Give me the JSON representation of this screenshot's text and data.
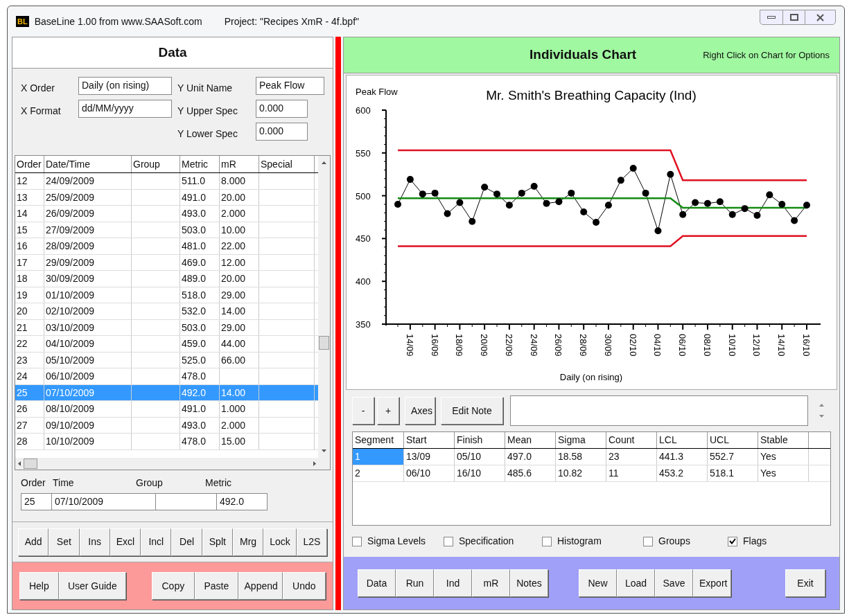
{
  "window": {
    "title": "BaseLine 1.00  from www.SAASoft.com",
    "project": "Project: \"Recipes XmR - 4f.bpf\"",
    "app_icon": "BL"
  },
  "data_panel": {
    "title": "Data",
    "fields": [
      {
        "label": "X Order",
        "value": "Daily (on rising)"
      },
      {
        "label": "X Format",
        "value": "dd/MM/yyyy"
      },
      {
        "label": "Y Unit Name",
        "value": "Peak Flow"
      },
      {
        "label": "Y Upper Spec",
        "value": "0.000"
      },
      {
        "label": "Y Lower Spec",
        "value": "0.000"
      }
    ],
    "table": {
      "columns": [
        "Order",
        "Date/Time",
        "Group",
        "Metric",
        "mR",
        "Special"
      ],
      "rows": [
        {
          "order": "12",
          "date": "24/09/2009",
          "metric": "511.0",
          "mr": "8.000",
          "selected": false
        },
        {
          "order": "13",
          "date": "25/09/2009",
          "metric": "491.0",
          "mr": "20.00",
          "selected": false
        },
        {
          "order": "14",
          "date": "26/09/2009",
          "metric": "493.0",
          "mr": "2.000",
          "selected": false
        },
        {
          "order": "15",
          "date": "27/09/2009",
          "metric": "503.0",
          "mr": "10.00",
          "selected": false
        },
        {
          "order": "16",
          "date": "28/09/2009",
          "metric": "481.0",
          "mr": "22.00",
          "selected": false
        },
        {
          "order": "17",
          "date": "29/09/2009",
          "metric": "469.0",
          "mr": "12.00",
          "selected": false
        },
        {
          "order": "18",
          "date": "30/09/2009",
          "metric": "489.0",
          "mr": "20.00",
          "selected": false
        },
        {
          "order": "19",
          "date": "01/10/2009",
          "metric": "518.0",
          "mr": "29.00",
          "selected": false
        },
        {
          "order": "20",
          "date": "02/10/2009",
          "metric": "532.0",
          "mr": "14.00",
          "selected": false
        },
        {
          "order": "21",
          "date": "03/10/2009",
          "metric": "503.0",
          "mr": "29.00",
          "selected": false
        },
        {
          "order": "22",
          "date": "04/10/2009",
          "metric": "459.0",
          "mr": "44.00",
          "selected": false
        },
        {
          "order": "23",
          "date": "05/10/2009",
          "metric": "525.0",
          "mr": "66.00",
          "selected": false
        },
        {
          "order": "24",
          "date": "06/10/2009",
          "metric": "478.0",
          "selected": false
        },
        {
          "order": "25",
          "date": "07/10/2009",
          "metric": "492.0",
          "mr": "14.00",
          "selected": true
        },
        {
          "order": "26",
          "date": "08/10/2009",
          "metric": "491.0",
          "mr": "1.000",
          "selected": false
        },
        {
          "order": "27",
          "date": "09/10/2009",
          "metric": "493.0",
          "mr": "2.000",
          "selected": false
        },
        {
          "order": "28",
          "date": "10/10/2009",
          "metric": "478.0",
          "mr": "15.00",
          "selected": false
        }
      ]
    },
    "editor": {
      "labels": [
        "Order",
        "Time",
        "Group",
        "Metric"
      ],
      "order": "25",
      "time": "07/10/2009",
      "metric": "492.0"
    },
    "edit_buttons": [
      "Add",
      "Set",
      "Ins",
      "Excl",
      "Incl",
      "Del",
      "Splt",
      "Mrg",
      "Lock",
      "L2S"
    ],
    "left_buttons": [
      "Help",
      "User Guide"
    ],
    "right_buttons": [
      "Copy",
      "Paste",
      "Append",
      "Undo"
    ]
  },
  "chart_panel": {
    "title": "Individuals Chart",
    "hint": "Right Click on Chart for Options",
    "chart_data": {
      "type": "line",
      "title": "Mr. Smith's Breathing Capacity (Ind)",
      "xlabel": "Daily (on rising)",
      "ylabel": "Peak Flow",
      "categories": [
        null,
        "14/09",
        null,
        "16/09",
        null,
        "18/09",
        null,
        "20/09",
        null,
        "22/09",
        null,
        "24/09",
        null,
        "26/09",
        null,
        "28/09",
        null,
        "30/09",
        null,
        "02/10",
        null,
        "04/10",
        null,
        "06/10",
        null,
        "08/10",
        null,
        "10/10",
        null,
        "12/10",
        null,
        "14/10",
        null,
        "16/10"
      ],
      "ylim": [
        350,
        600
      ],
      "yticks": [
        350,
        400,
        450,
        500,
        550,
        600
      ],
      "series": [
        {
          "color": "#000000",
          "marker": "circle",
          "values": [
            490,
            519,
            502,
            503,
            479,
            492,
            470,
            510,
            502,
            489,
            503,
            511,
            491,
            493,
            503,
            481,
            469,
            489,
            518,
            532,
            503,
            459,
            525,
            478,
            492,
            491,
            493,
            478,
            485,
            477,
            501,
            490,
            471,
            489
          ]
        },
        {
          "color": "#138a13",
          "values": [
            497,
            497,
            497,
            497,
            497,
            497,
            497,
            497,
            497,
            497,
            497,
            497,
            497,
            497,
            497,
            497,
            497,
            497,
            497,
            497,
            497,
            497,
            497,
            486,
            486,
            486,
            486,
            486,
            486,
            486,
            486,
            486,
            486,
            486
          ]
        },
        {
          "color": "#e01020",
          "values": [
            553,
            553,
            553,
            553,
            553,
            553,
            553,
            553,
            553,
            553,
            553,
            553,
            553,
            553,
            553,
            553,
            553,
            553,
            553,
            553,
            553,
            553,
            553,
            518,
            518,
            518,
            518,
            518,
            518,
            518,
            518,
            518,
            518,
            518
          ]
        },
        {
          "color": "#e01020",
          "values": [
            441,
            441,
            441,
            441,
            441,
            441,
            441,
            441,
            441,
            441,
            441,
            441,
            441,
            441,
            441,
            441,
            441,
            441,
            441,
            441,
            441,
            441,
            441,
            453,
            453,
            453,
            453,
            453,
            453,
            453,
            453,
            453,
            453,
            453
          ]
        }
      ]
    },
    "chart_buttons": [
      "-",
      "+",
      "Axes",
      "Edit Note"
    ],
    "segments": {
      "columns": [
        "Segment",
        "Start",
        "Finish",
        "Mean",
        "Sigma",
        "Count",
        "LCL",
        "UCL",
        "Stable"
      ],
      "rows": [
        {
          "cells": [
            "1",
            "13/09",
            "05/10",
            "497.0",
            "18.58",
            "23",
            "441.3",
            "552.7",
            "Yes"
          ],
          "selected": true
        },
        {
          "cells": [
            "2",
            "06/10",
            "16/10",
            "485.6",
            "10.82",
            "11",
            "453.2",
            "518.1",
            "Yes"
          ],
          "selected": false
        }
      ]
    },
    "options": [
      {
        "label": "Sigma Levels",
        "checked": false
      },
      {
        "label": "Specification",
        "checked": false
      },
      {
        "label": "Histogram",
        "checked": false
      },
      {
        "label": "Groups",
        "checked": false
      },
      {
        "label": "Flags",
        "checked": true
      }
    ],
    "view_buttons": [
      "Data",
      "Run",
      "Ind",
      "mR",
      "Notes"
    ],
    "file_buttons": [
      "New",
      "Load",
      "Save",
      "Export"
    ],
    "exit_button": "Exit"
  }
}
